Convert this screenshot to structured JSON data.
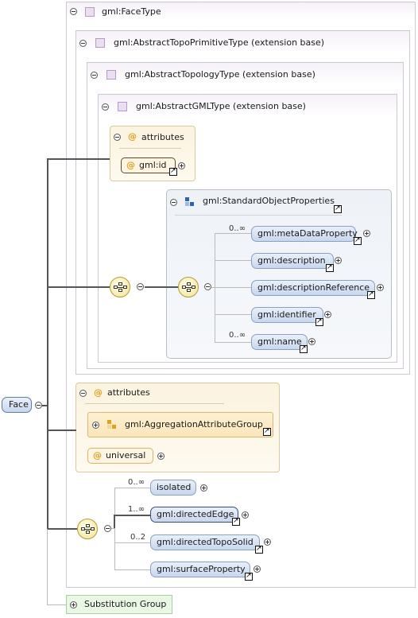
{
  "root": {
    "label": "Face"
  },
  "types": {
    "face_type": "gml:FaceType",
    "abstract_topo_primitive": "gml:AbstractTopoPrimitiveType (extension base)",
    "abstract_topology": "gml:AbstractTopologyType (extension base)",
    "abstract_gml": "gml:AbstractGMLType (extension base)"
  },
  "inner_attributes": {
    "header": "attributes",
    "id_attr": "gml:id"
  },
  "standard_object_properties": {
    "title": "gml:StandardObjectProperties",
    "elements": [
      {
        "label": "gml:metaDataProperty",
        "cardinality": "0..∞"
      },
      {
        "label": "gml:description",
        "cardinality": ""
      },
      {
        "label": "gml:descriptionReference",
        "cardinality": ""
      },
      {
        "label": "gml:identifier",
        "cardinality": ""
      },
      {
        "label": "gml:name",
        "cardinality": "0..∞"
      }
    ]
  },
  "outer_attributes": {
    "header": "attributes",
    "group": "gml:AggregationAttributeGroup",
    "universal": "universal"
  },
  "face_elements": [
    {
      "label": "isolated",
      "cardinality": "0..∞"
    },
    {
      "label": "gml:directedEdge",
      "cardinality": "1..∞"
    },
    {
      "label": "gml:directedTopoSolid",
      "cardinality": "0..2"
    },
    {
      "label": "gml:surfaceProperty",
      "cardinality": ""
    }
  ],
  "substitution_group": "Substitution Group"
}
